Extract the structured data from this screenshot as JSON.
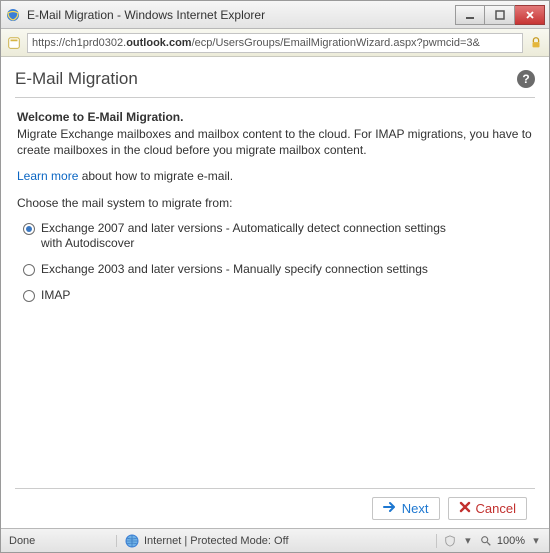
{
  "window": {
    "title": "E-Mail Migration - Windows Internet Explorer"
  },
  "address": {
    "scheme": "https://",
    "host_pre": "ch1prd0302.",
    "host_bold": "outlook.com",
    "path": "/ecp/UsersGroups/EmailMigrationWizard.aspx?pwmcid=3&"
  },
  "page": {
    "title": "E-Mail Migration",
    "welcome_heading": "Welcome to E-Mail Migration.",
    "welcome_body": "Migrate Exchange mailboxes and mailbox content to the cloud. For IMAP migrations, you have to create mailboxes in the cloud before you migrate mailbox content.",
    "learn_more_link": "Learn more",
    "learn_more_rest": " about how to migrate e-mail.",
    "choose_prompt": "Choose the mail system to migrate from:",
    "options": [
      {
        "label": "Exchange 2007 and later versions - Automatically detect connection settings with Autodiscover",
        "selected": true
      },
      {
        "label": "Exchange 2003 and later versions - Manually specify connection settings",
        "selected": false
      },
      {
        "label": "IMAP",
        "selected": false
      }
    ],
    "next_label": "Next",
    "cancel_label": "Cancel"
  },
  "status": {
    "left": "Done",
    "mid": "Internet | Protected Mode: Off",
    "zoom": "100%"
  }
}
